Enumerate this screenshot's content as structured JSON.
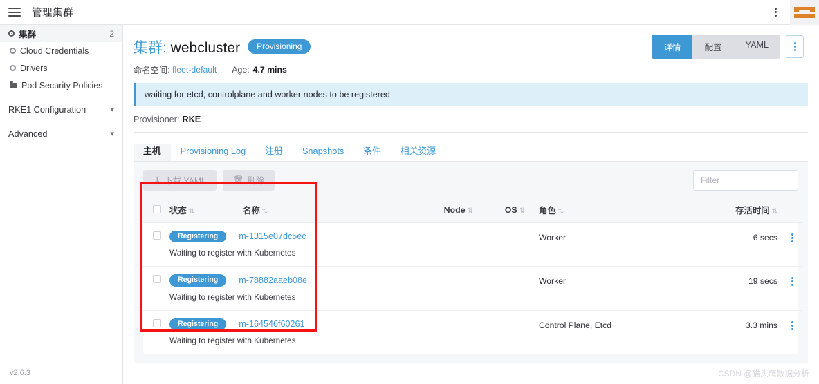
{
  "topbar": {
    "menu_icon": "hamburger-icon",
    "title": "管理集群",
    "kebab_icon": "kebab-menu-icon",
    "logo": "rancher-logo"
  },
  "sidebar": {
    "items": [
      {
        "label": "集群",
        "icon": "cluster-icon",
        "count": "2",
        "active": true
      },
      {
        "label": "Cloud Credentials",
        "icon": "circle-icon",
        "count": "",
        "active": false
      },
      {
        "label": "Drivers",
        "icon": "circle-icon",
        "count": "",
        "active": false
      },
      {
        "label": "Pod Security Policies",
        "icon": "folder-icon",
        "count": "",
        "active": false
      }
    ],
    "groups": [
      {
        "label": "RKE1 Configuration",
        "chevron": "chevron-down-icon"
      },
      {
        "label": "Advanced",
        "chevron": "chevron-down-icon"
      }
    ],
    "version": "v2.6.3"
  },
  "header": {
    "title_prefix": "集群",
    "title_sep": ": ",
    "cluster_name": "webcluster",
    "status_badge": "Provisioning",
    "namespace_label": "命名空间",
    "namespace_value": "fleet-default",
    "age_label": "Age:",
    "age_value": "4.7 mins",
    "actions": [
      {
        "label": "详情",
        "active": true
      },
      {
        "label": "配置",
        "active": false
      },
      {
        "label": "YAML",
        "active": false
      }
    ],
    "action_kebab": "kebab-menu-icon"
  },
  "banner": {
    "message": "waiting for etcd, controlplane and worker nodes to be registered"
  },
  "provisioner": {
    "label": "Provisioner:",
    "value": "RKE"
  },
  "tabs": [
    {
      "label": "主机",
      "active": true
    },
    {
      "label": "Provisioning Log",
      "active": false
    },
    {
      "label": "注册",
      "active": false
    },
    {
      "label": "Snapshots",
      "active": false
    },
    {
      "label": "条件",
      "active": false
    },
    {
      "label": "相关资源",
      "active": false
    }
  ],
  "toolbar": {
    "download_yaml": "下载 YAML",
    "download_icon": "download-icon",
    "delete": "删除",
    "delete_icon": "trash-icon",
    "filter_placeholder": "Filter",
    "filter_value": ""
  },
  "table": {
    "columns": [
      {
        "key": "checkbox",
        "label": ""
      },
      {
        "key": "state",
        "label": "状态"
      },
      {
        "key": "name",
        "label": "名称"
      },
      {
        "key": "node",
        "label": "Node"
      },
      {
        "key": "os",
        "label": "OS"
      },
      {
        "key": "role",
        "label": "角色"
      },
      {
        "key": "age",
        "label": "存活时间"
      },
      {
        "key": "actions",
        "label": ""
      }
    ],
    "sort_icon": "sort-arrows-icon",
    "rows": [
      {
        "state": "Registering",
        "name": "m-1315e07dc5ec",
        "node": "",
        "os": "",
        "role": "Worker",
        "age": "6 secs",
        "message": "Waiting to register with Kubernetes"
      },
      {
        "state": "Registering",
        "name": "m-78882aaeb08e",
        "node": "",
        "os": "",
        "role": "Worker",
        "age": "19 secs",
        "message": "Waiting to register with Kubernetes"
      },
      {
        "state": "Registering",
        "name": "m-164546f60261",
        "node": "",
        "os": "",
        "role": "Control Plane, Etcd",
        "age": "3.3 mins",
        "message": "Waiting to register with Kubernetes"
      }
    ]
  },
  "annotation": {
    "color": "#f51313"
  },
  "watermark": "CSDN @猫头鹰数据分析",
  "colors": {
    "accent_blue": "#3d98d3",
    "banner_bg": "#ddeff9",
    "logo_orange": "#dd8227",
    "panel_bg": "#f6f7f9"
  }
}
